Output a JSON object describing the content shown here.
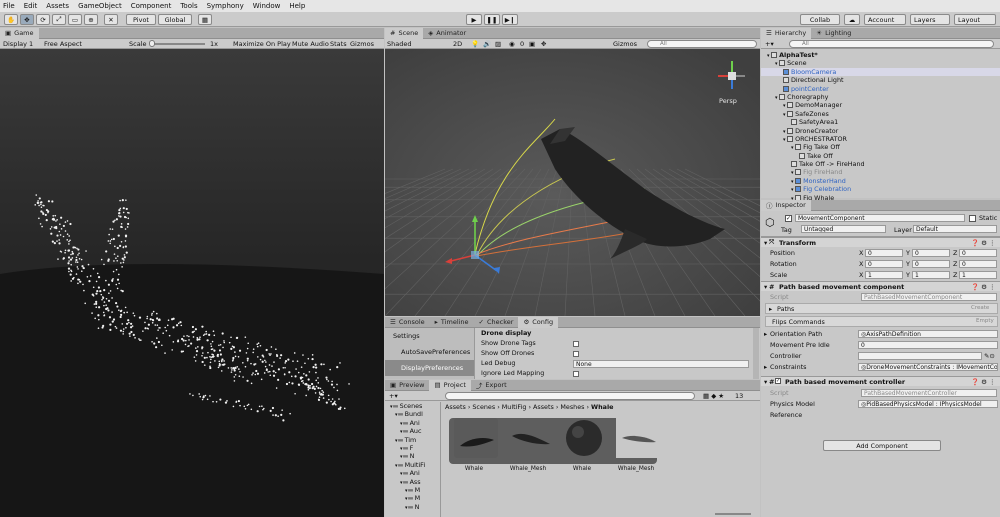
{
  "menu": [
    "File",
    "Edit",
    "Assets",
    "GameObject",
    "Component",
    "Tools",
    "Symphony",
    "Window",
    "Help"
  ],
  "toolbar": {
    "pivot": "Pivot",
    "global": "Global",
    "collab": "Collab",
    "account": "Account",
    "layers": "Layers",
    "layout": "Layout"
  },
  "game": {
    "tab": "Game",
    "display": "Display 1",
    "aspect": "Free Aspect",
    "scale_label": "Scale",
    "scale_val": "1x",
    "maximize": "Maximize On Play",
    "mute": "Mute Audio",
    "stats": "Stats",
    "gizmos": "Gizmos"
  },
  "scene": {
    "tab": "Scene",
    "animator": "Animator",
    "shaded": "Shaded",
    "mode2d": "2D",
    "gizmos": "Gizmos",
    "search": "All",
    "persp": "Persp",
    "counter": "0"
  },
  "hierarchy": {
    "tab": "Hierarchy",
    "lighting": "Lighting",
    "search": "All",
    "items": [
      {
        "label": "AlphaTest*",
        "indent": 0,
        "bold": true,
        "style": ""
      },
      {
        "label": "Scene",
        "indent": 1,
        "style": ""
      },
      {
        "label": "BloomCamera",
        "indent": 2,
        "style": "hl"
      },
      {
        "label": "Directional Light",
        "indent": 2,
        "style": ""
      },
      {
        "label": "pointCenter",
        "indent": 2,
        "style": "blue"
      },
      {
        "label": "Choregraphy",
        "indent": 1,
        "style": ""
      },
      {
        "label": "DemoManager",
        "indent": 2,
        "style": ""
      },
      {
        "label": "SafeZones",
        "indent": 2,
        "style": ""
      },
      {
        "label": "SafetyArea1",
        "indent": 3,
        "style": ""
      },
      {
        "label": "DroneCreator",
        "indent": 2,
        "style": ""
      },
      {
        "label": "ORCHESTRATOR",
        "indent": 2,
        "style": ""
      },
      {
        "label": "Fig Take Off",
        "indent": 3,
        "style": ""
      },
      {
        "label": "Take Off",
        "indent": 4,
        "style": ""
      },
      {
        "label": "Take Off -> FireHand",
        "indent": 3,
        "style": ""
      },
      {
        "label": "Fig FireHand",
        "indent": 3,
        "style": "gray"
      },
      {
        "label": "MonsterHand",
        "indent": 3,
        "style": "blue"
      },
      {
        "label": "Fig Celebration",
        "indent": 3,
        "style": "blue"
      },
      {
        "label": "Fig Whale",
        "indent": 3,
        "style": ""
      }
    ]
  },
  "inspector": {
    "tab": "Inspector",
    "object": "MovementComponent",
    "static": "Static",
    "tag_label": "Tag",
    "tag": "Untagged",
    "layer_label": "Layer",
    "layer": "Default",
    "transform": "Transform",
    "position": {
      "label": "Position",
      "x": "0",
      "y": "0",
      "z": "0"
    },
    "rotation": {
      "label": "Rotation",
      "x": "0",
      "y": "0",
      "z": "0"
    },
    "scale": {
      "label": "Scale",
      "x": "1",
      "y": "1",
      "z": "1"
    },
    "pbmc": "Path based movement component",
    "script_label": "Script",
    "script1": "PathBasedMovementComponent",
    "paths": "Paths",
    "paths_btn": "Create",
    "flips": "Flips Commands",
    "flips_btn": "Empty",
    "orient_label": "Orientation Path",
    "orient": "◎AxisPathDefinition",
    "idle_label": "Movement Pre Idle",
    "idle": "0",
    "controller_label": "Controller",
    "controller": "",
    "constraints_label": "Constraints",
    "constraints": "◎DroneMovementConstraints : IMovementCo",
    "pbctrl": "Path based movement controller",
    "script2": "PathBasedMovementController",
    "physics_label": "Physics Model",
    "physics": "◎PidBasedPhysicsModel : IPhysicsModel",
    "reference": "Reference",
    "add": "Add Component"
  },
  "bottom": {
    "tabs": [
      "Console",
      "Timeline",
      "Checker",
      "Config"
    ],
    "settings": "Settings",
    "autosave": "AutoSavePreferences",
    "display": "DisplayPreferences",
    "drone_display": "Drone display",
    "opts": [
      {
        "label": "Show Drone Tags",
        "val": ""
      },
      {
        "label": "Show Off Drones",
        "val": ""
      },
      {
        "label": "Led Debug",
        "val": "None"
      },
      {
        "label": "Ignore Led Mapping",
        "val": ""
      }
    ]
  },
  "project": {
    "preview": "Preview",
    "project": "Project",
    "export": "Export",
    "count": "13",
    "breadcrumb": [
      "Assets",
      "Scenes",
      "MultiFig",
      "Assets",
      "Meshes",
      "Whale"
    ],
    "tree": [
      {
        "label": "Scenes",
        "indent": 1
      },
      {
        "label": "Bundl",
        "indent": 2
      },
      {
        "label": "Ani",
        "indent": 3
      },
      {
        "label": "Auc",
        "indent": 3
      },
      {
        "label": "Tim",
        "indent": 2
      },
      {
        "label": "F",
        "indent": 3
      },
      {
        "label": "N",
        "indent": 3
      },
      {
        "label": "MultiFi",
        "indent": 2
      },
      {
        "label": "Ani",
        "indent": 3
      },
      {
        "label": "Ass",
        "indent": 3
      },
      {
        "label": "M",
        "indent": 4
      },
      {
        "label": "M",
        "indent": 4
      },
      {
        "label": "N",
        "indent": 4
      }
    ],
    "assets": [
      "Whale",
      "Whale_Mesh",
      "Whale",
      "Whale_Mesh"
    ]
  }
}
